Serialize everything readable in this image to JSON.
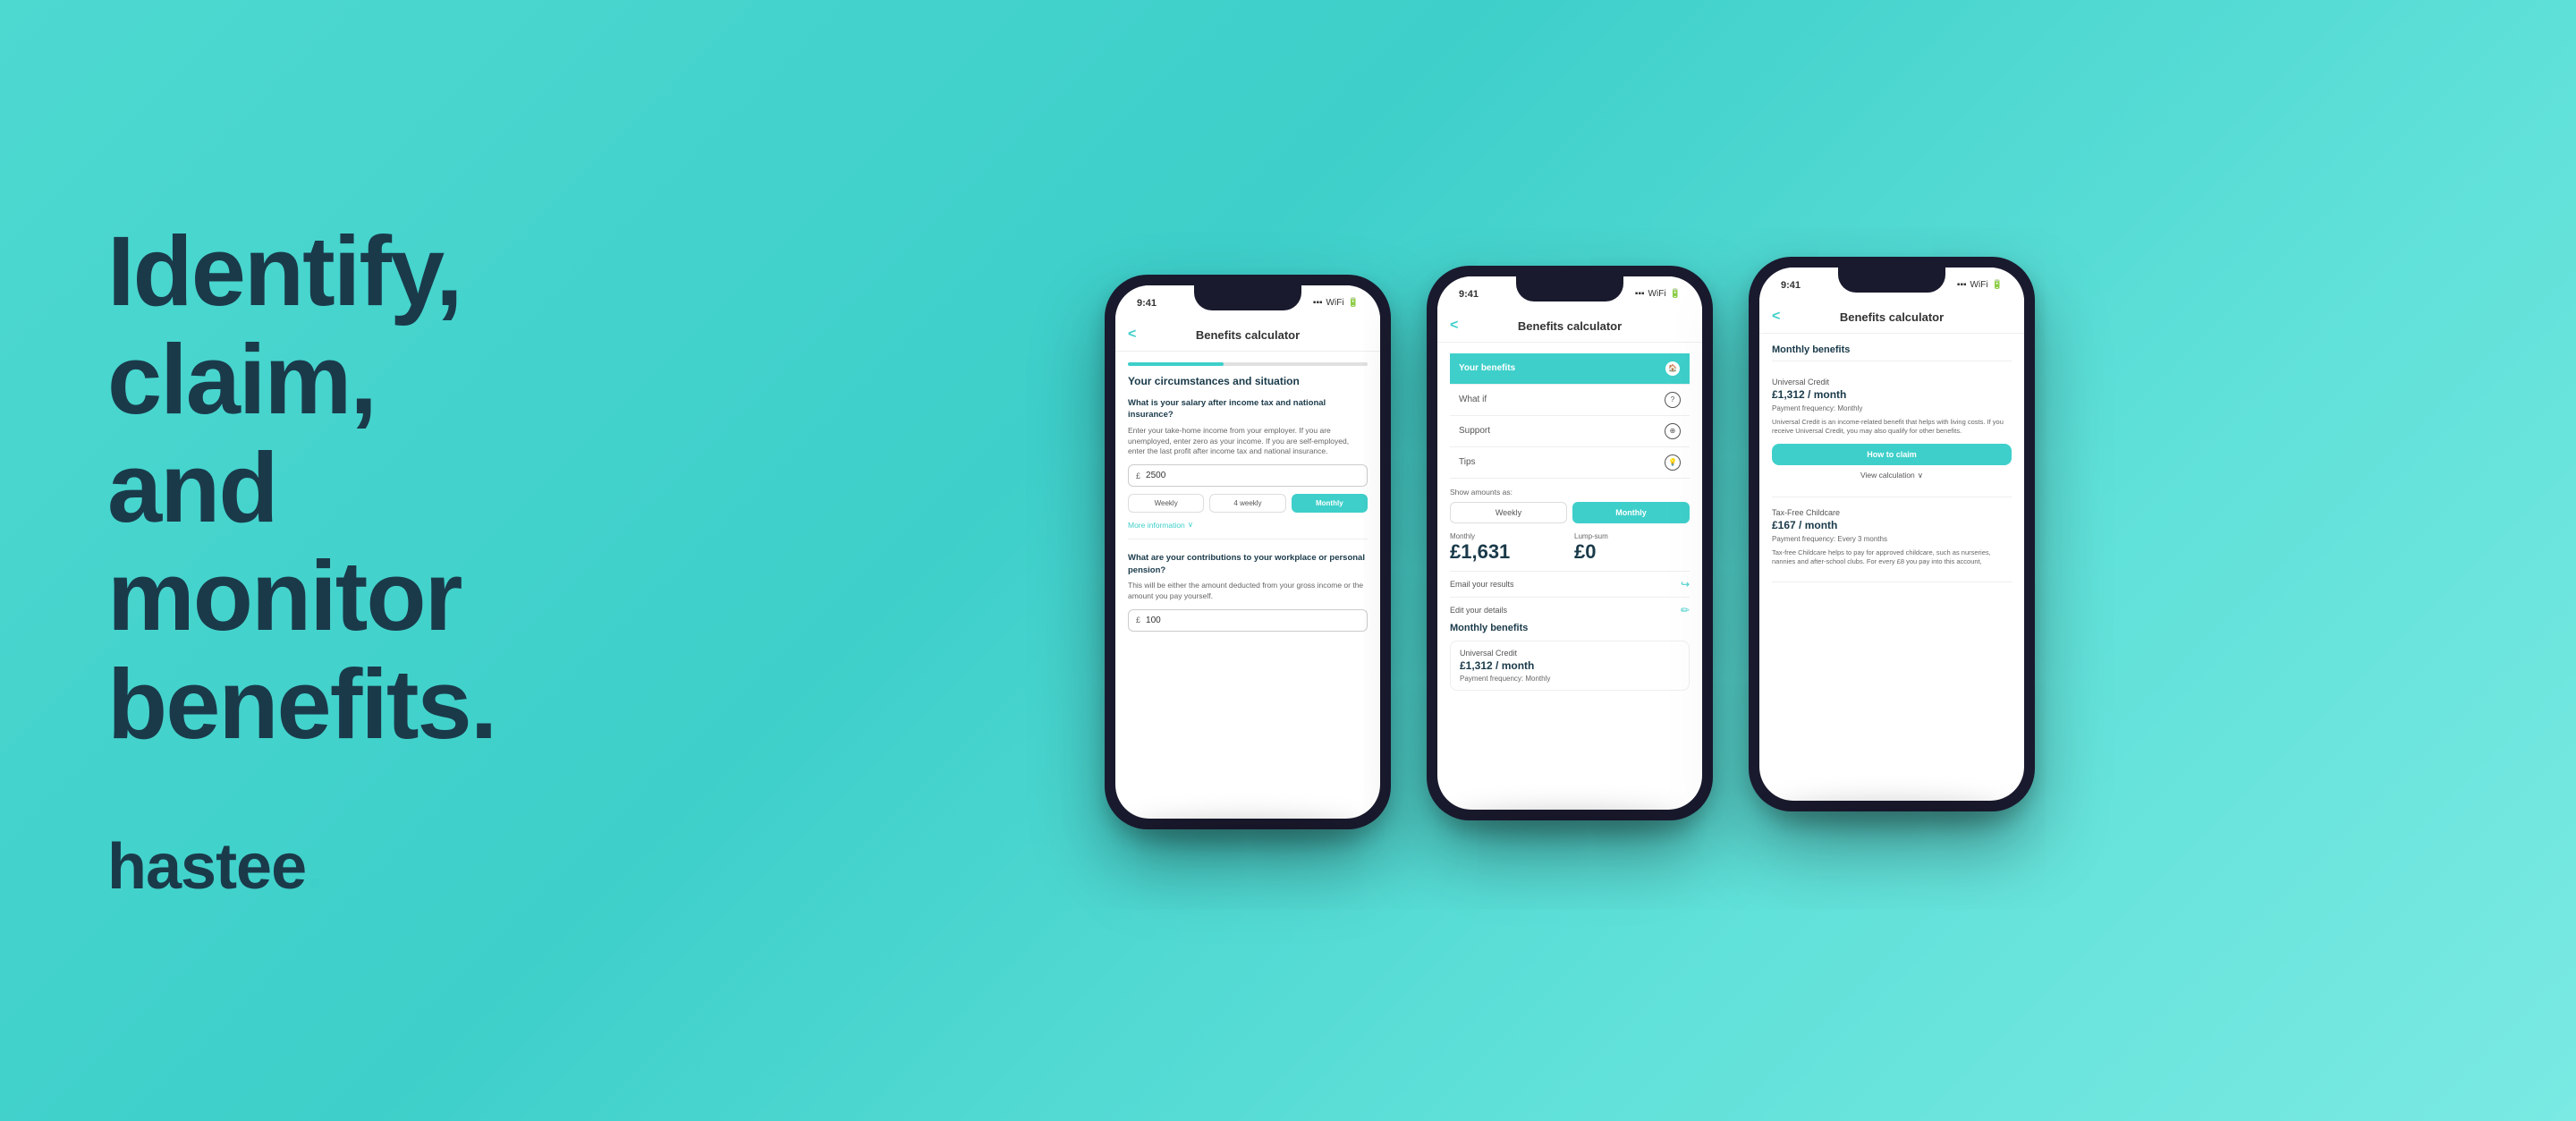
{
  "background": {
    "gradient_start": "#4dd9d0",
    "gradient_end": "#7aeae3"
  },
  "headline": {
    "line1": "Identify, claim,",
    "line2": "and monitor",
    "line3": "benefits."
  },
  "logo": {
    "text": "hastee",
    "dot": "."
  },
  "phone1": {
    "status_time": "9:41",
    "header_title": "Benefits calculator",
    "back_label": "<",
    "section_title": "Your circumstances and situation",
    "question1_label": "What is your salary after income tax and national insurance?",
    "question1_desc": "Enter your take-home income from your employer. If you are unemployed, enter zero as your income. If you are self-employed, enter the last profit after income tax and national insurance.",
    "input1_currency": "£",
    "input1_value": "2500",
    "freq_buttons": [
      "Weekly",
      "4 weekly",
      "Monthly"
    ],
    "active_freq": "Monthly",
    "more_info_label": "More information",
    "question2_label": "What are your contributions to your workplace or personal pension?",
    "question2_desc": "This will be either the amount deducted from your gross income or the amount you pay yourself.",
    "input2_currency": "£",
    "input2_value": "100"
  },
  "phone2": {
    "status_time": "9:41",
    "header_title": "Benefits calculator",
    "back_label": "<",
    "tabs": [
      {
        "label": "Your benefits",
        "icon": "🏠",
        "active": true
      },
      {
        "label": "What if",
        "icon": "?",
        "active": false
      },
      {
        "label": "Support",
        "icon": "⊕",
        "active": false
      },
      {
        "label": "Tips",
        "icon": "💡",
        "active": false
      }
    ],
    "show_amounts_label": "Show amounts as:",
    "toggle_buttons": [
      "Weekly",
      "Monthly"
    ],
    "active_toggle": "Monthly",
    "monthly_label": "Monthly",
    "lump_sum_label": "Lump-sum",
    "monthly_amount": "£1,631",
    "lump_sum_amount": "£0",
    "email_results_label": "Email your results",
    "edit_details_label": "Edit your details",
    "monthly_benefits_title": "Monthly benefits",
    "benefit1_name": "Universal Credit",
    "benefit1_amount": "£1,312 / month",
    "benefit1_freq": "Payment frequency: Monthly"
  },
  "phone3": {
    "status_time": "9:41",
    "header_title": "Benefits calculator",
    "back_label": "<",
    "monthly_benefits_title": "Monthly benefits",
    "benefit1_name": "Universal Credit",
    "benefit1_amount": "£1,312 / month",
    "benefit1_freq": "Payment frequency: Monthly",
    "benefit1_desc": "Universal Credit is an income-related benefit that helps with living costs. If you receive Universal Credit, you may also qualify for other benefits.",
    "how_to_claim_label": "How to claim",
    "view_calculation_label": "View calculation",
    "benefit2_name": "Tax-Free Childcare",
    "benefit2_amount": "£167 / month",
    "benefit2_freq": "Payment frequency: Every 3 months",
    "benefit2_desc": "Tax-free Childcare helps to pay for approved childcare, such as nurseries, nannies and after-school clubs. For every £8 you pay into this account,"
  }
}
